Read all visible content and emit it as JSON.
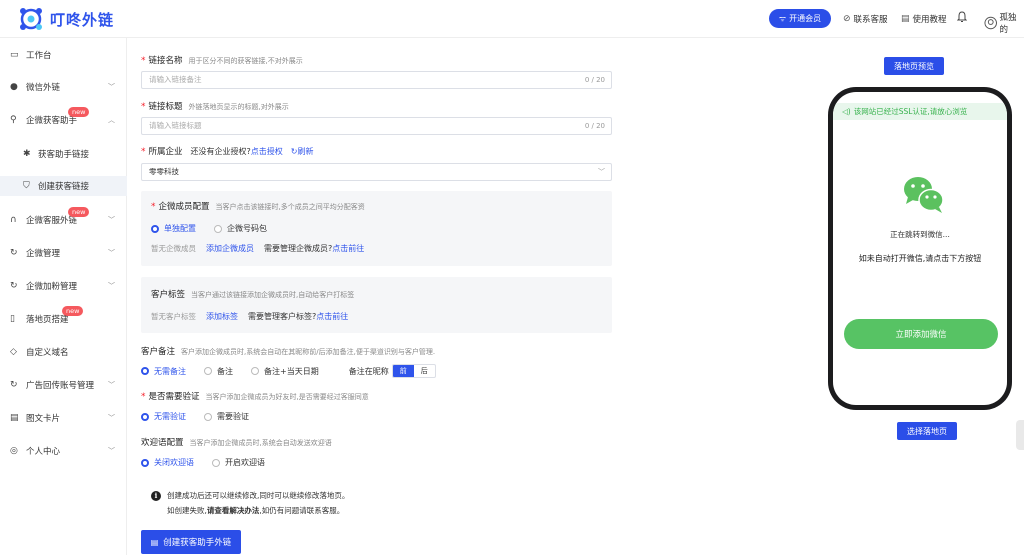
{
  "header": {
    "logo_text": "叮咚外链",
    "vip_label": "开通会员",
    "links": [
      {
        "label": "联系客服",
        "icon": "link-icon"
      },
      {
        "label": "使用教程",
        "icon": "book-icon"
      }
    ],
    "user_name": "孤独的"
  },
  "sidebar": {
    "items": [
      {
        "label": "工作台",
        "icon": "monitor-icon",
        "chevron": false,
        "badge": ""
      },
      {
        "label": "微信外链",
        "icon": "wechat-icon",
        "chevron": true,
        "badge": ""
      },
      {
        "label": "企微获客助手",
        "icon": "search-icon",
        "chevron": true,
        "badge": "new",
        "expanded": true
      },
      {
        "label": "获客助手链接",
        "icon": "nodes-icon",
        "sub": true
      },
      {
        "label": "创建获客链接",
        "icon": "shield-icon",
        "sub": true,
        "active": true
      },
      {
        "label": "企微客服外链",
        "icon": "headset-icon",
        "chevron": true,
        "badge": "new"
      },
      {
        "label": "企微管理",
        "icon": "refresh-icon",
        "chevron": true,
        "badge": ""
      },
      {
        "label": "企微加粉管理",
        "icon": "refresh-icon",
        "chevron": true,
        "badge": ""
      },
      {
        "label": "落地页搭建",
        "icon": "page-icon",
        "chevron": false,
        "badge": "new"
      },
      {
        "label": "自定义域名",
        "icon": "diamond-icon",
        "chevron": false,
        "badge": ""
      },
      {
        "label": "广告回传账号管理",
        "icon": "refresh-icon",
        "chevron": true,
        "badge": ""
      },
      {
        "label": "图文卡片",
        "icon": "card-icon",
        "chevron": true,
        "badge": ""
      },
      {
        "label": "个人中心",
        "icon": "user-icon",
        "chevron": true,
        "badge": ""
      }
    ]
  },
  "form": {
    "link_name": {
      "label": "链接名称",
      "hint": "用于区分不同的获客链接,不对外展示",
      "placeholder": "请输入链接备注",
      "count": "0 / 20"
    },
    "link_title": {
      "label": "链接标题",
      "hint": "外链落地页显示的标题,对外展示",
      "placeholder": "请输入链接标题",
      "count": "0 / 20"
    },
    "company": {
      "label": "所属企业",
      "question": "还没有企业授权?",
      "auth_link": "点击授权",
      "refresh": "刷新",
      "value": "零零科技"
    },
    "members": {
      "label": "企微成员配置",
      "hint": "当客户点击该链接时,多个成员之间平均分配客资",
      "options": [
        "单独配置",
        "企微号码包"
      ],
      "empty": "暂无企微成员",
      "add_link": "添加企微成员",
      "manage_q": "需要管理企微成员?",
      "goto": "点击前往"
    },
    "tags": {
      "label": "客户标签",
      "hint": "当客户通过该链接添加企微成员时,自动给客户打标签",
      "empty": "暂无客户标签",
      "add_link": "添加标签",
      "manage_q": "需要管理客户标签?",
      "goto": "点击前往"
    },
    "remark": {
      "label": "客户备注",
      "hint": "客户添加企微成员时,系统会自动在其昵称前/后添加备注,便于渠道识别与客户管理.",
      "options": [
        "无需备注",
        "备注",
        "备注+当天日期"
      ],
      "position_label": "备注在昵称",
      "position_options": [
        "前",
        "后"
      ]
    },
    "verify": {
      "label": "是否需要验证",
      "hint": "当客户添加企微成员为好友时,是否需要经过客服同意",
      "options": [
        "无需验证",
        "需要验证"
      ]
    },
    "welcome": {
      "label": "欢迎语配置",
      "hint": "当客户添加企微成员时,系统会自动发送欢迎语",
      "options": [
        "关闭欢迎语",
        "开启欢迎语"
      ]
    },
    "notice": {
      "line1": "创建成功后还可以继续修改,同时可以继续修改落地页。",
      "line2_prefix": "如创建失败,",
      "line2_bold": "请查看解决办法",
      "line2_suffix": ",如仍有问题请联系客服。"
    },
    "submit_label": "创建获客助手外链"
  },
  "preview": {
    "top_button": "落地页预览",
    "ssl_text": "该网站已经过SSL认证,请放心浏览",
    "jumping_text": "正在跳转到微信...",
    "hint_text": "如未自动打开微信,请点击下方按钮",
    "add_button": "立即添加微信",
    "bottom_button": "选择落地页"
  },
  "colors": {
    "primary": "#2b4ee8",
    "wechat_green": "#57c364",
    "badge_red": "#f5595e",
    "ssl_green": "#37b24d"
  }
}
